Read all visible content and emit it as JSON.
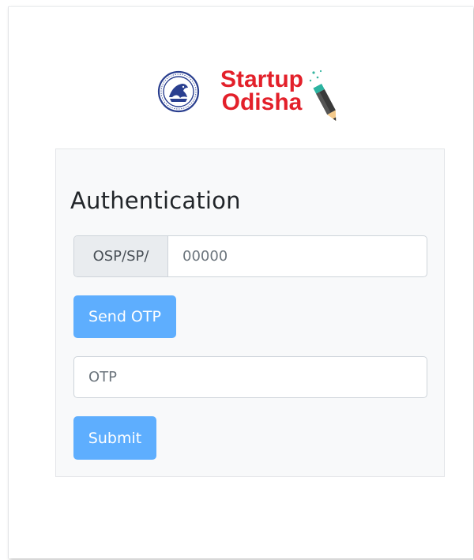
{
  "logo": {
    "line1": "Startup",
    "line2": "Odisha",
    "emblem_icon": "odisha-emblem-icon",
    "pencil_icon": "pencil-icon",
    "brand_color": "#e3202a"
  },
  "auth": {
    "heading": "Authentication",
    "id_prefix": "OSP/SP/",
    "id_placeholder": "00000",
    "send_otp_label": "Send OTP",
    "otp_placeholder": "OTP",
    "submit_label": "Submit"
  },
  "colors": {
    "button": "#5eaefe",
    "card_bg": "#f8f9fa",
    "prefix_bg": "#e9ecef"
  }
}
